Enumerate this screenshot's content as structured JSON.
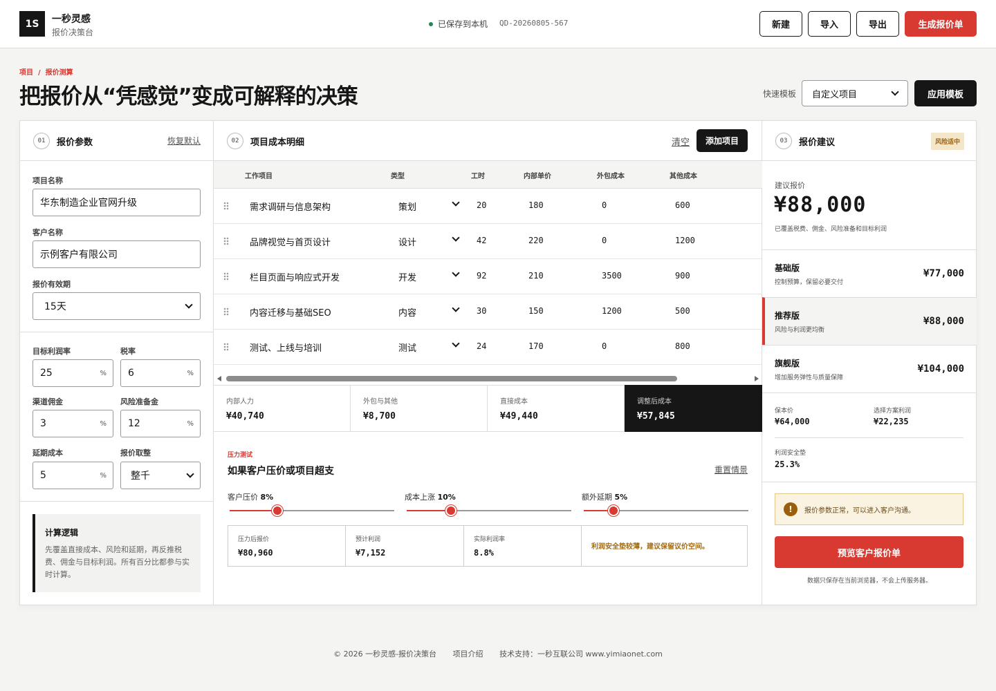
{
  "header": {
    "logo": "1S",
    "brand": "一秒灵感",
    "brand_sub": "报价决策台",
    "saved": "已保存到本机",
    "quote_id": "QD-20260805-567",
    "buttons": {
      "new": "新建",
      "import": "导入",
      "export": "导出",
      "generate": "生成报价单"
    }
  },
  "page": {
    "breadcrumb": "项目  /  报价测算",
    "title": "把报价从“凭感觉”变成可解释的决策",
    "template_label": "快速模板",
    "template_value": "自定义项目",
    "apply_template": "应用模板"
  },
  "params": {
    "num": "01",
    "title": "报价参数",
    "reset": "恢复默认",
    "project_name_label": "项目名称",
    "project_name": "华东制造企业官网升级",
    "client_name_label": "客户名称",
    "client_name": "示例客户有限公司",
    "validity_label": "报价有效期",
    "validity": "15天",
    "margin_label": "目标利润率",
    "margin": "25",
    "tax_label": "税率",
    "tax": "6",
    "commission_label": "渠道佣金",
    "commission": "3",
    "risk_label": "风险准备金",
    "risk": "12",
    "delay_label": "延期成本",
    "delay": "5",
    "rounding_label": "报价取整",
    "rounding": "整千",
    "pct": "%",
    "logic_title": "计算逻辑",
    "logic_desc": "先覆盖直接成本、风险和延期，再反推税费、佣金与目标利润。所有百分比都参与实时计算。"
  },
  "costs": {
    "num": "02",
    "title": "项目成本明细",
    "clear": "清空",
    "add": "添加项目",
    "headers": [
      "工作项目",
      "类型",
      "工时",
      "内部单价",
      "外包成本",
      "其他成本"
    ],
    "rows": [
      {
        "name": "需求调研与信息架构",
        "type": "策划",
        "hours": "20",
        "rate": "180",
        "outsource": "0",
        "other": "600"
      },
      {
        "name": "品牌视觉与首页设计",
        "type": "设计",
        "hours": "42",
        "rate": "220",
        "outsource": "0",
        "other": "1200"
      },
      {
        "name": "栏目页面与响应式开发",
        "type": "开发",
        "hours": "92",
        "rate": "210",
        "outsource": "3500",
        "other": "900"
      },
      {
        "name": "内容迁移与基础SEO",
        "type": "内容",
        "hours": "30",
        "rate": "150",
        "outsource": "1200",
        "other": "500"
      },
      {
        "name": "测试、上线与培训",
        "type": "测试",
        "hours": "24",
        "rate": "170",
        "outsource": "0",
        "other": "800"
      }
    ],
    "summary": [
      {
        "label": "内部人力",
        "value": "¥40,740"
      },
      {
        "label": "外包与其他",
        "value": "¥8,700"
      },
      {
        "label": "直接成本",
        "value": "¥49,440"
      },
      {
        "label": "调整后成本",
        "value": "¥57,845"
      }
    ]
  },
  "stress": {
    "kicker": "压力测试",
    "title": "如果客户压价或项目超支",
    "reset": "重置情景",
    "sliders": [
      {
        "label": "客户压价",
        "value": "8%",
        "level": 0.29
      },
      {
        "label": "成本上涨",
        "value": "10%",
        "level": 0.27
      },
      {
        "label": "额外延期",
        "value": "5%",
        "level": 0.18
      }
    ],
    "results": [
      {
        "label": "压力后报价",
        "value": "¥80,960"
      },
      {
        "label": "预计利润",
        "value": "¥7,152"
      },
      {
        "label": "实际利润率",
        "value": "8.8%"
      }
    ],
    "warning": "利润安全垫较薄，建议保留议价空间。"
  },
  "suggest": {
    "num": "03",
    "title": "报价建议",
    "badge": "风险适中",
    "label": "建议报价",
    "value": "¥88,000",
    "desc": "已覆盖税费、佣金、风险准备和目标利润",
    "tiers": [
      {
        "name": "基础版",
        "desc": "控制预算，保留必要交付",
        "price": "¥77,000"
      },
      {
        "name": "推荐版",
        "desc": "风险与利润更均衡",
        "price": "¥88,000"
      },
      {
        "name": "旗舰版",
        "desc": "增加服务弹性与质量保障",
        "price": "¥104,000"
      }
    ],
    "floor_label": "保本价",
    "floor": "¥64,000",
    "profit_label": "选择方案利润",
    "profit": "¥22,235",
    "safety_label": "利润安全垫",
    "safety": "25.3%",
    "notice": "报价参数正常，可以进入客户沟通。",
    "notice_icon": "!",
    "preview": "预览客户报价单",
    "local": "数据只保存在当前浏览器，不会上传服务器。"
  },
  "footer": {
    "copyright": "© 2026 一秒灵感-报价决策台",
    "about": "项目介绍",
    "support": "技术支持：一秒互联公司 www.yimiaonet.com"
  },
  "colors": {
    "accent": "#d83a32",
    "dark": "#161616",
    "ok": "#1f8a55",
    "warn": "#a36c12"
  }
}
